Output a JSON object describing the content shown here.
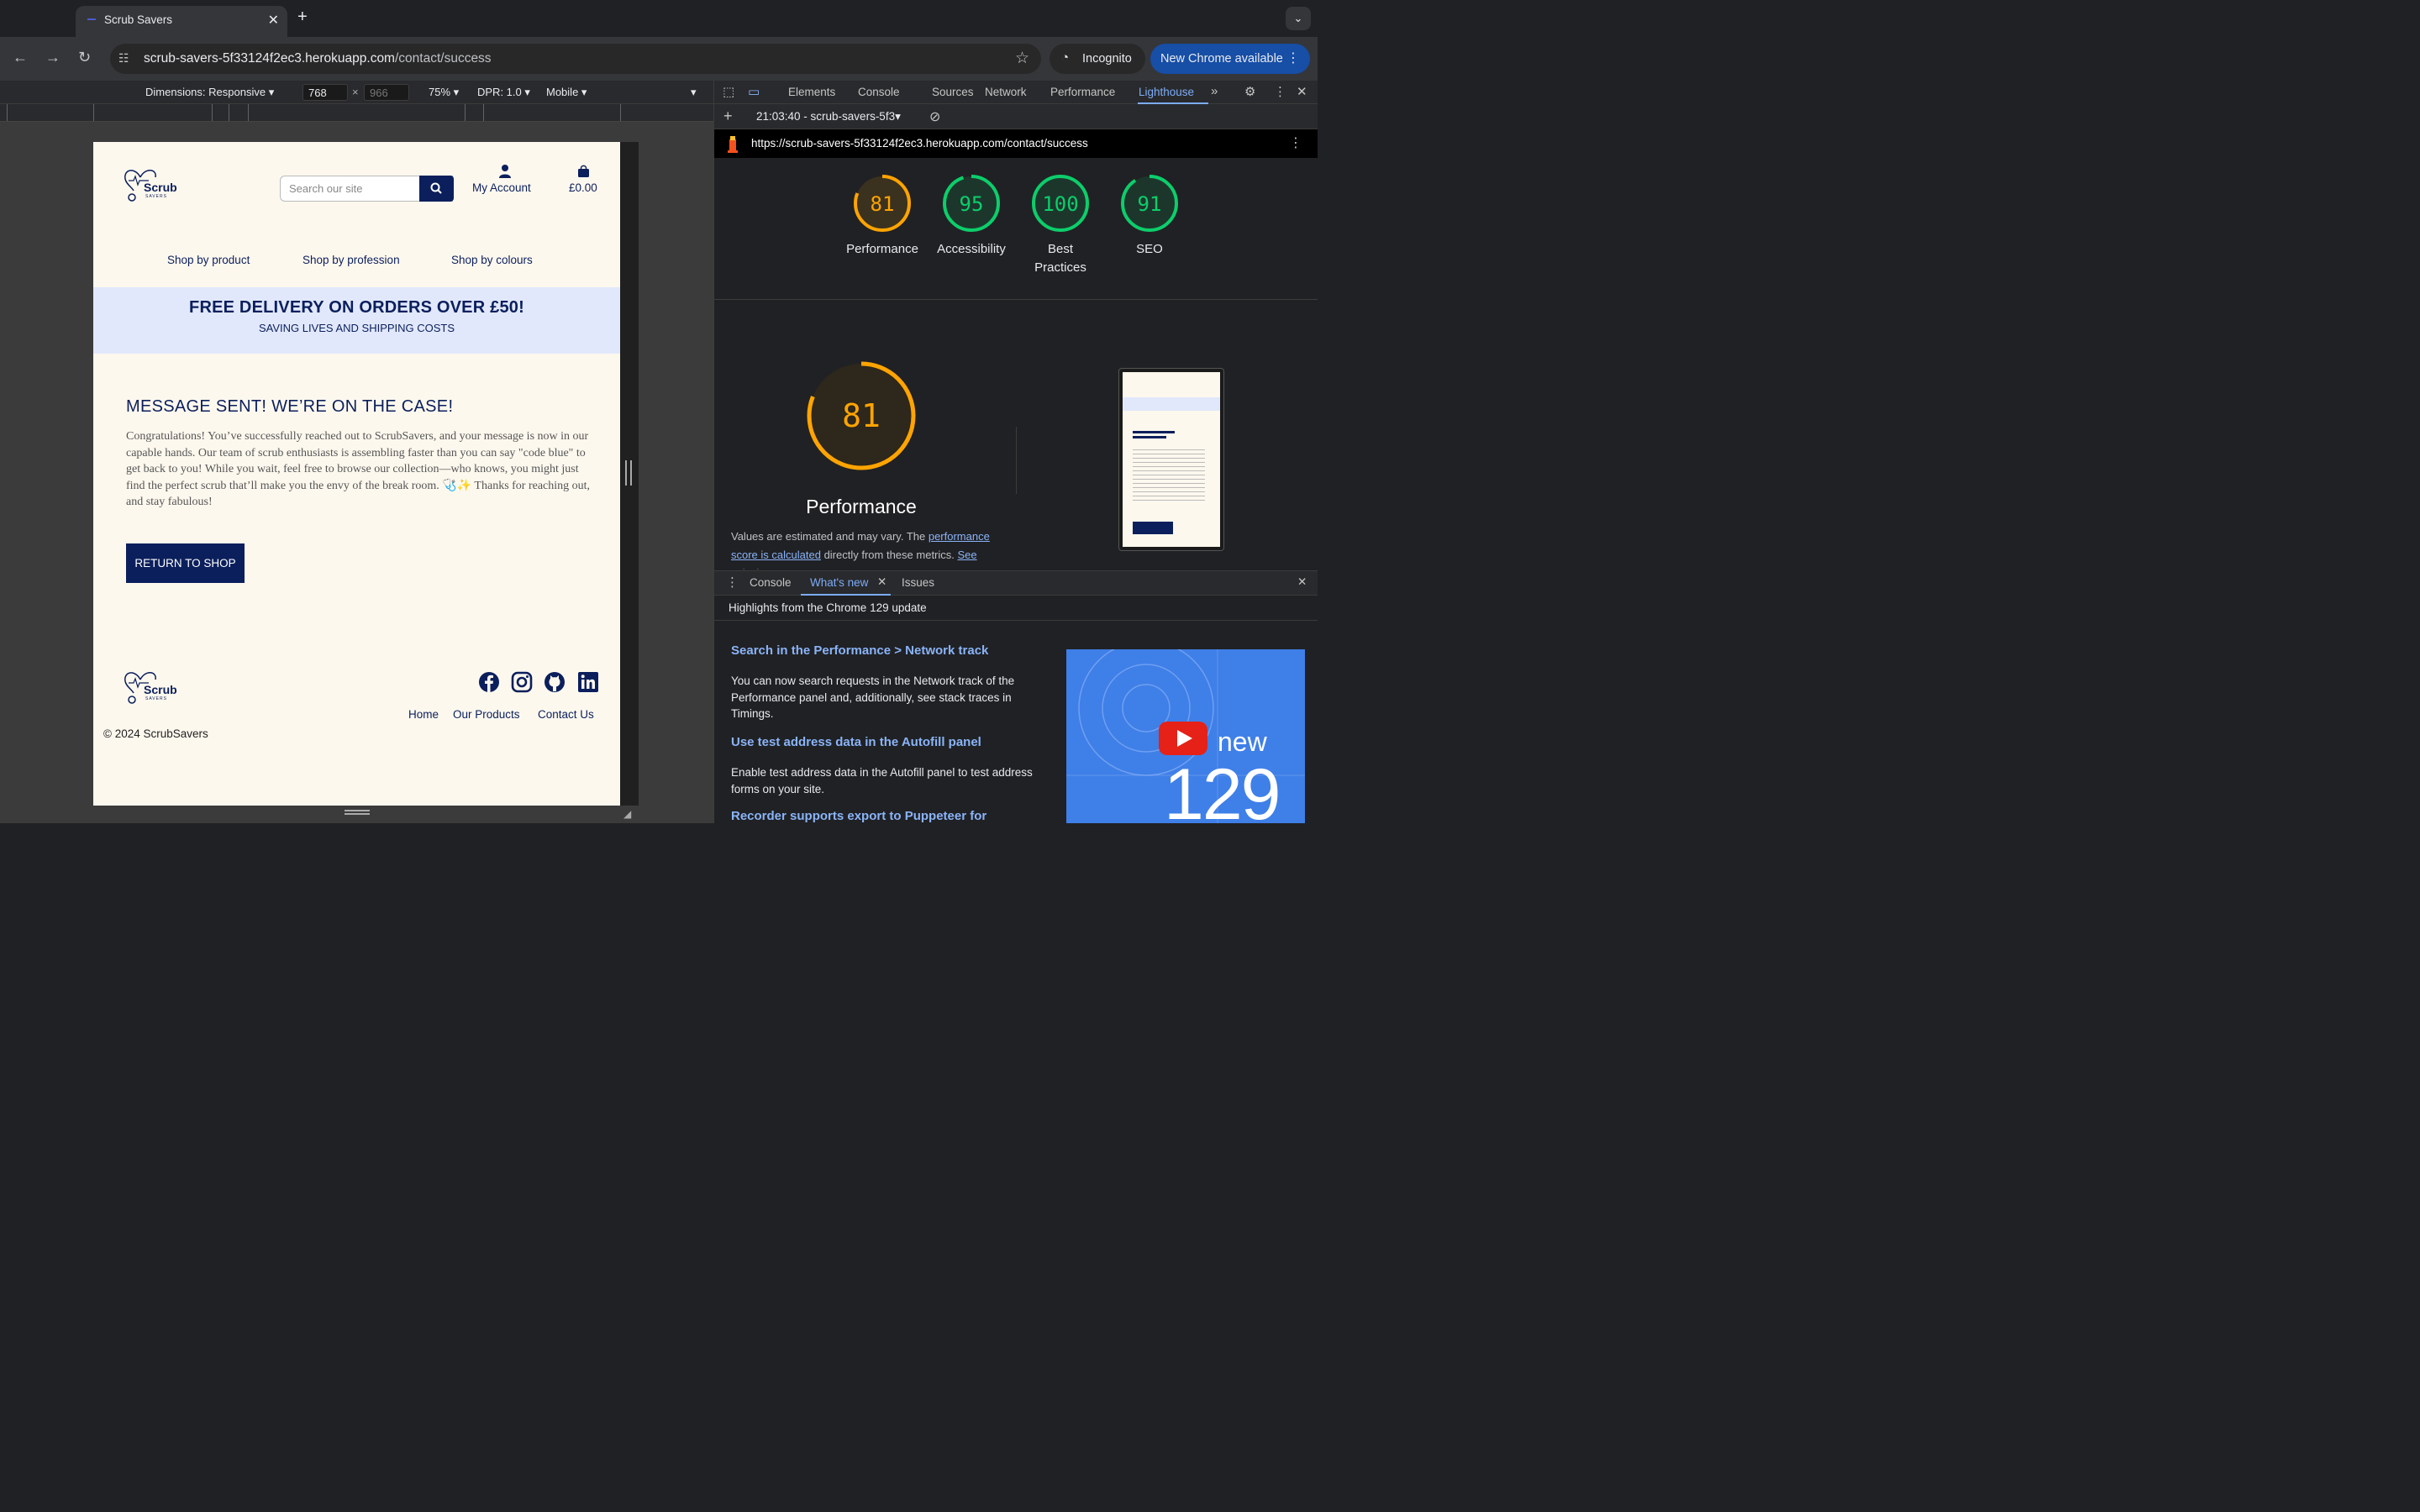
{
  "browser": {
    "tab_title": "Scrub Savers",
    "url_host": "scrub-savers-5f33124f2ec3.herokuapp.com",
    "url_path": "/contact/success",
    "incognito_label": "Incognito",
    "new_chrome_label": "New Chrome available"
  },
  "device_toolbar": {
    "dimensions": "Dimensions: Responsive",
    "width": "768",
    "height": "966",
    "zoom": "75%",
    "dpr": "DPR: 1.0",
    "mode": "Mobile"
  },
  "site": {
    "logo_text": "Scrub",
    "logo_sub": "SAVERS",
    "search_placeholder": "Search our site",
    "account_label": "My Account",
    "cart_total": "£0.00",
    "nav": [
      "Shop by product",
      "Shop by profession",
      "Shop by colours"
    ],
    "banner_title": "FREE DELIVERY ON ORDERS OVER £50!",
    "banner_sub": "SAVING LIVES AND SHIPPING COSTS",
    "message_title": "MESSAGE SENT! WE’RE ON THE CASE!",
    "message_body": "Congratulations! You’ve successfully reached out to ScrubSavers, and your message is now in our capable hands. Our team of scrub enthusiasts is assembling faster than you can say \"code blue\" to get back to you! While you wait, feel free to browse our collection—who knows, you might just find the perfect scrub that’ll make you the envy of the break room. 🩺✨ Thanks for reaching out, and stay fabulous!",
    "return_button": "RETURN TO SHOP",
    "footer_links": [
      "Home",
      "Our Products",
      "Contact Us"
    ],
    "copyright": "© 2024 ScrubSavers",
    "social_icons": [
      "facebook-icon",
      "instagram-icon",
      "github-icon",
      "linkedin-icon"
    ],
    "brand_color": "#0b1f5c",
    "banner_color": "#e1e8fb"
  },
  "devtools": {
    "tabs": [
      "Elements",
      "Console",
      "Sources",
      "Network",
      "Performance",
      "Lighthouse"
    ],
    "active_tab": "Lighthouse",
    "report_label": "21:03:40 - scrub-savers-5f3",
    "report_url": "https://scrub-savers-5f33124f2ec3.herokuapp.com/contact/success",
    "scores": [
      {
        "value": "81",
        "label": "Performance",
        "color": "#ffa400"
      },
      {
        "value": "95",
        "label": "Accessibility",
        "color": "#0cce6b"
      },
      {
        "value": "100",
        "label": "Best Practices",
        "color": "#0cce6b"
      },
      {
        "value": "91",
        "label": "SEO",
        "color": "#0cce6b"
      }
    ],
    "big_score": "81",
    "big_label": "Performance",
    "note_pre": "Values are estimated and may vary. The ",
    "note_link1": "performance score is calculated",
    "note_mid": " directly from these metrics. ",
    "note_link2": "See calculator."
  },
  "drawer": {
    "tabs": [
      "Console",
      "What's new",
      "Issues"
    ],
    "active_tab": "What's new",
    "heading": "Highlights from the Chrome 129 update",
    "items": [
      {
        "title": "Search in the Performance > Network track",
        "body": "You can now search requests in the Network track of the Performance panel and, additionally, see stack traces in Timings."
      },
      {
        "title": "Use test address data in the Autofill panel",
        "body": "Enable test address data in the Autofill panel to test address forms on your site."
      },
      {
        "title": "Recorder supports export to Puppeteer for",
        "body": ""
      }
    ],
    "video_new": "new",
    "video_version": "129"
  }
}
